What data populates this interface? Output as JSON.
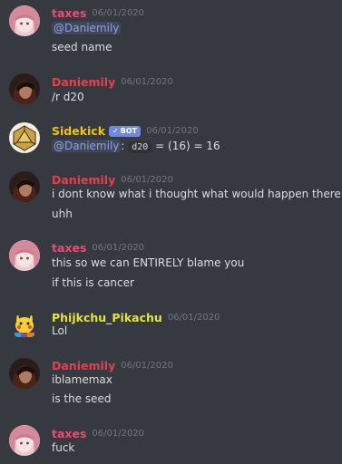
{
  "colors": {
    "background": "#36393f",
    "taxes": "#e84d75",
    "daniemily": "#e0434e",
    "sidekick": "#f1c40f",
    "phijkchu": "#e3e34a",
    "mention": "#8ea1e1",
    "bot_tag": "#7289da",
    "timestamp": "#72767d"
  },
  "messages": [
    {
      "author": "taxes",
      "timestamp": "06/01/2020",
      "avatar_icon": "anime-girl-avatar",
      "mention": "@Daniemily",
      "lines": [
        "seed name"
      ]
    },
    {
      "author": "Daniemily",
      "timestamp": "06/01/2020",
      "avatar_icon": "dark-portrait-avatar",
      "lines": [
        "/r d20"
      ]
    },
    {
      "author": "Sidekick",
      "bot_tag": "BOT",
      "bot_check": "✓",
      "timestamp": "06/01/2020",
      "avatar_icon": "d20-dice-avatar",
      "mention": "@Daniemily",
      "colon": ":",
      "code": "d20",
      "result": "= (16) = 16"
    },
    {
      "author": "Daniemily",
      "timestamp": "06/01/2020",
      "avatar_icon": "dark-portrait-avatar",
      "lines": [
        "i dont know what i thought what would happen there",
        "uhh"
      ]
    },
    {
      "author": "taxes",
      "timestamp": "06/01/2020",
      "avatar_icon": "anime-girl-avatar",
      "lines": [
        "this so we can ENTIRELY blame you",
        "if this is cancer"
      ]
    },
    {
      "author": "Phijkchu_Pikachu",
      "timestamp": "06/01/2020",
      "avatar_icon": "pikachu-avatar",
      "lines": [
        "Lol"
      ]
    },
    {
      "author": "Daniemily",
      "timestamp": "06/01/2020",
      "avatar_icon": "dark-portrait-avatar",
      "lines": [
        "iblamemax",
        "is the seed"
      ]
    },
    {
      "author": "taxes",
      "timestamp": "06/01/2020",
      "avatar_icon": "anime-girl-avatar",
      "lines": [
        "fuck"
      ]
    }
  ]
}
